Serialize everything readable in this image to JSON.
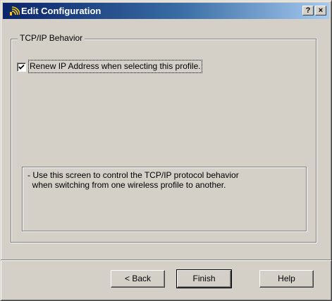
{
  "window": {
    "title": "Edit Configuration",
    "help_button": "?",
    "close_button": "×"
  },
  "group": {
    "label": "TCP/IP Behavior",
    "checkbox_label": "Renew IP Address when selecting this profile.",
    "checkbox_checked": true
  },
  "info": {
    "text": "- Use this screen to control the TCP/IP protocol behavior\n  when switching from one wireless profile to another."
  },
  "buttons": {
    "back": "< Back",
    "finish": "Finish",
    "help": "Help"
  }
}
